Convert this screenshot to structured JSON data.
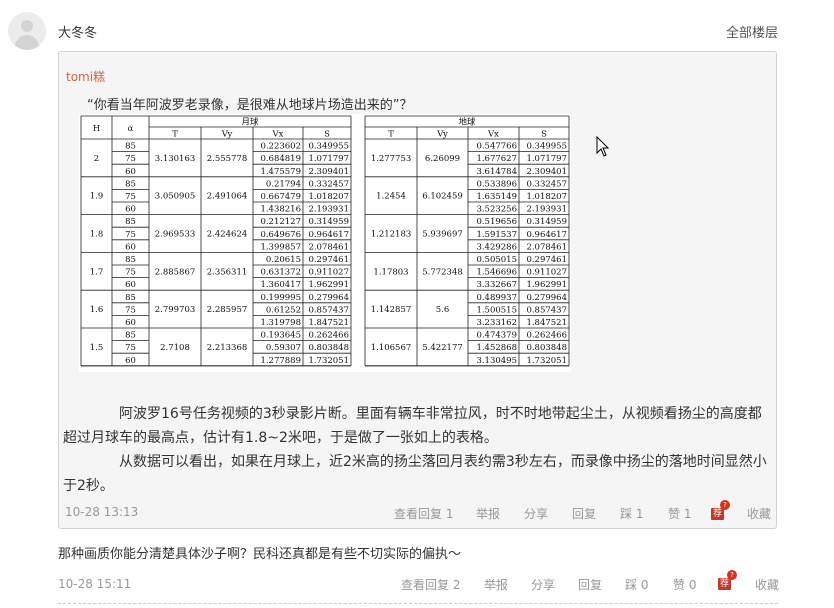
{
  "header": {
    "username": "大冬冬",
    "all_floors": "全部楼层"
  },
  "quote": {
    "author": "tomi糕",
    "first_line": "“你看当年阿波罗老录像，是很难从地球片场造出来的”？",
    "paragraph1": "阿波罗16号任务视频的3秒录影片断。里面有辆车非常拉风，时不时地带起尘土，从视频看扬尘的高度都超过月球车的最高点，估计有1.8~2米吧，于是做了一张如上的表格。",
    "paragraph2": "从数据可以看出，如果在月球上，近2米高的扬尘落回月表约需3秒左右，而录像中扬尘的落地时间显然小于2秒。",
    "time": "10-28 13:13",
    "actions": {
      "view_replies": "查看回复 1",
      "report": "举报",
      "share": "分享",
      "reply": "回复",
      "dislike": "踩 1",
      "like": "赞 1",
      "recommend": "荐",
      "recommend_badge": "?",
      "favorite": "收藏"
    },
    "table": {
      "group_moon": "月球",
      "group_earth": "地球",
      "col_h": "H",
      "col_a": "α",
      "cols": [
        "T",
        "Vy",
        "Vx",
        "S"
      ],
      "rows": [
        {
          "h": "2",
          "t_moon": "3.130163",
          "vy_moon": "2.555778",
          "t_earth": "1.277753",
          "vy_earth": "6.26099",
          "sub": [
            {
              "a": "85",
              "vx_moon": "0.223602",
              "s_moon": "0.349955",
              "vx_earth": "0.547766",
              "s_earth": "0.349955"
            },
            {
              "a": "75",
              "vx_moon": "0.684819",
              "s_moon": "1.071797",
              "vx_earth": "1.677627",
              "s_earth": "1.071797"
            },
            {
              "a": "60",
              "vx_moon": "1.475579",
              "s_moon": "2.309401",
              "vx_earth": "3.614784",
              "s_earth": "2.309401"
            }
          ]
        },
        {
          "h": "1.9",
          "t_moon": "3.050905",
          "vy_moon": "2.491064",
          "t_earth": "1.2454",
          "vy_earth": "6.102459",
          "sub": [
            {
              "a": "85",
              "vx_moon": "0.21794",
              "s_moon": "0.332457",
              "vx_earth": "0.533896",
              "s_earth": "0.332457"
            },
            {
              "a": "75",
              "vx_moon": "0.667479",
              "s_moon": "1.018207",
              "vx_earth": "1.635149",
              "s_earth": "1.018207"
            },
            {
              "a": "60",
              "vx_moon": "1.438216",
              "s_moon": "2.193931",
              "vx_earth": "3.523256",
              "s_earth": "2.193931"
            }
          ]
        },
        {
          "h": "1.8",
          "t_moon": "2.969533",
          "vy_moon": "2.424624",
          "t_earth": "1.212183",
          "vy_earth": "5.939697",
          "sub": [
            {
              "a": "85",
              "vx_moon": "0.212127",
              "s_moon": "0.314959",
              "vx_earth": "0.519656",
              "s_earth": "0.314959"
            },
            {
              "a": "75",
              "vx_moon": "0.649676",
              "s_moon": "0.964617",
              "vx_earth": "1.591537",
              "s_earth": "0.964617"
            },
            {
              "a": "60",
              "vx_moon": "1.399857",
              "s_moon": "2.078461",
              "vx_earth": "3.429286",
              "s_earth": "2.078461"
            }
          ]
        },
        {
          "h": "1.7",
          "t_moon": "2.885867",
          "vy_moon": "2.356311",
          "t_earth": "1.17803",
          "vy_earth": "5.772348",
          "sub": [
            {
              "a": "85",
              "vx_moon": "0.20615",
              "s_moon": "0.297461",
              "vx_earth": "0.505015",
              "s_earth": "0.297461"
            },
            {
              "a": "75",
              "vx_moon": "0.631372",
              "s_moon": "0.911027",
              "vx_earth": "1.546696",
              "s_earth": "0.911027"
            },
            {
              "a": "60",
              "vx_moon": "1.360417",
              "s_moon": "1.962991",
              "vx_earth": "3.332667",
              "s_earth": "1.962991"
            }
          ]
        },
        {
          "h": "1.6",
          "t_moon": "2.799703",
          "vy_moon": "2.285957",
          "t_earth": "1.142857",
          "vy_earth": "5.6",
          "sub": [
            {
              "a": "85",
              "vx_moon": "0.199995",
              "s_moon": "0.279964",
              "vx_earth": "0.489937",
              "s_earth": "0.279964"
            },
            {
              "a": "75",
              "vx_moon": "0.61252",
              "s_moon": "0.857437",
              "vx_earth": "1.500515",
              "s_earth": "0.857437"
            },
            {
              "a": "60",
              "vx_moon": "1.319798",
              "s_moon": "1.847521",
              "vx_earth": "3.233162",
              "s_earth": "1.847521"
            }
          ]
        },
        {
          "h": "1.5",
          "t_moon": "2.7108",
          "vy_moon": "2.213368",
          "t_earth": "1.106567",
          "vy_earth": "5.422177",
          "sub": [
            {
              "a": "85",
              "vx_moon": "0.193645",
              "s_moon": "0.262466",
              "vx_earth": "0.474379",
              "s_earth": "0.262466"
            },
            {
              "a": "75",
              "vx_moon": "0.59307",
              "s_moon": "0.803848",
              "vx_earth": "1.452868",
              "s_earth": "0.803848"
            },
            {
              "a": "60",
              "vx_moon": "1.277889",
              "s_moon": "1.732051",
              "vx_earth": "3.130495",
              "s_earth": "1.732051"
            }
          ]
        }
      ]
    }
  },
  "reply": {
    "text": "那种画质你能分清楚具体沙子啊？民科还真都是有些不切实际的偏执～",
    "time": "10-28 15:11",
    "actions": {
      "view_replies": "查看回复 2",
      "report": "举报",
      "share": "分享",
      "reply": "回复",
      "dislike": "踩 0",
      "like": "赞 0",
      "recommend": "荐",
      "recommend_badge": "?",
      "favorite": "收藏"
    }
  }
}
